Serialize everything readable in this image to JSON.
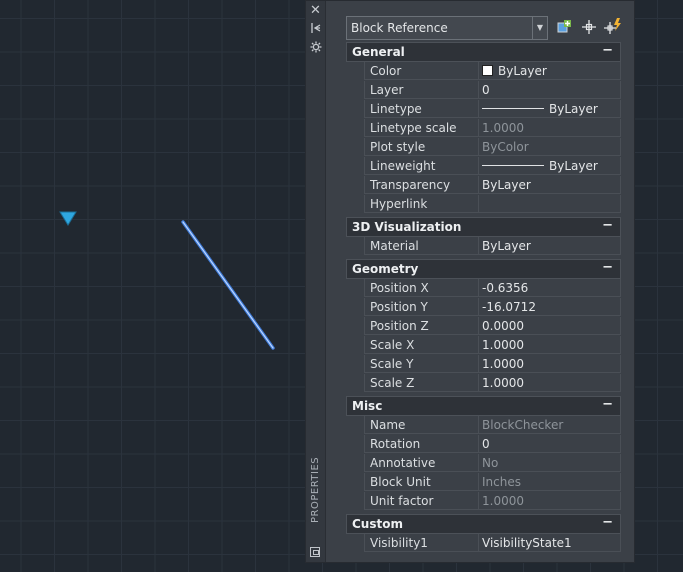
{
  "palette": {
    "title": "PROPERTIES",
    "selector": {
      "value": "Block Reference"
    },
    "sections": [
      {
        "title": "General",
        "toggle": "−",
        "rows": [
          {
            "label": "Color",
            "value": "ByLayer",
            "kind": "color",
            "dim": false
          },
          {
            "label": "Layer",
            "value": "0",
            "dim": false
          },
          {
            "label": "Linetype",
            "value": "ByLayer",
            "kind": "line",
            "dim": false
          },
          {
            "label": "Linetype scale",
            "value": "1.0000",
            "dim": true
          },
          {
            "label": "Plot style",
            "value": "ByColor",
            "dim": true
          },
          {
            "label": "Lineweight",
            "value": "ByLayer",
            "kind": "line",
            "dim": false
          },
          {
            "label": "Transparency",
            "value": "ByLayer",
            "dim": false
          },
          {
            "label": "Hyperlink",
            "value": "",
            "dim": false
          }
        ]
      },
      {
        "title": "3D Visualization",
        "toggle": "−",
        "rows": [
          {
            "label": "Material",
            "value": "ByLayer",
            "dim": false
          }
        ]
      },
      {
        "title": "Geometry",
        "toggle": "−",
        "rows": [
          {
            "label": "Position X",
            "value": "-0.6356",
            "dim": false
          },
          {
            "label": "Position Y",
            "value": "-16.0712",
            "dim": false
          },
          {
            "label": "Position Z",
            "value": "0.0000",
            "dim": false
          },
          {
            "label": "Scale X",
            "value": "1.0000",
            "dim": false
          },
          {
            "label": "Scale Y",
            "value": "1.0000",
            "dim": false
          },
          {
            "label": "Scale Z",
            "value": "1.0000",
            "dim": false
          }
        ]
      },
      {
        "title": "Misc",
        "toggle": "−",
        "rows": [
          {
            "label": "Name",
            "value": "BlockChecker",
            "dim": true
          },
          {
            "label": "Rotation",
            "value": "0",
            "dim": false
          },
          {
            "label": "Annotative",
            "value": "No",
            "dim": true
          },
          {
            "label": "Block Unit",
            "value": "Inches",
            "dim": true
          },
          {
            "label": "Unit factor",
            "value": "1.0000",
            "dim": true
          }
        ]
      },
      {
        "title": "Custom",
        "toggle": "−",
        "rows": [
          {
            "label": "Visibility1",
            "value": "VisibilityState1",
            "dim": false
          }
        ]
      }
    ]
  },
  "icons": {
    "close": "close-icon",
    "autohide": "autohide-icon",
    "settings": "settings-icon",
    "quick_select": "quick-select-icon",
    "select_objects": "select-objects-icon",
    "toggle_pickadd": "toggle-pickadd-icon",
    "grip": "visibility-grip-icon"
  },
  "colors": {
    "grid_bg": "#212830",
    "selected_line": "#5a9cff",
    "grip": "#2fa7e0"
  }
}
